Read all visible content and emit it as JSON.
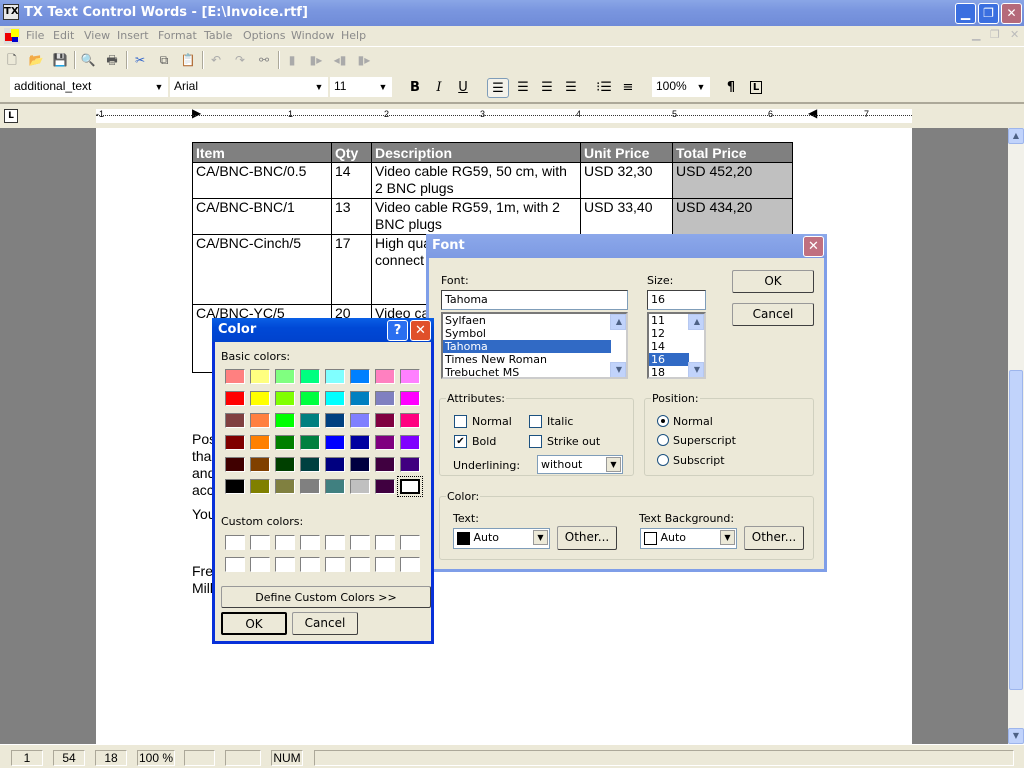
{
  "window": {
    "title": "TX Text Control Words - [E:\\Invoice.rtf]",
    "app_icon": "TX"
  },
  "menu": [
    "File",
    "Edit",
    "View",
    "Insert",
    "Format",
    "Table",
    "Options",
    "Window",
    "Help"
  ],
  "toolbar": {
    "style": "additional_text",
    "font": "Arial",
    "size": "11",
    "zoom": "100%",
    "bold": "B",
    "italic": "I",
    "underline": "U",
    "pilcrow": "¶"
  },
  "ruler": {
    "labels": [
      "-1",
      "1",
      "2",
      "3",
      "4",
      "5",
      "6",
      "7"
    ]
  },
  "document": {
    "table": {
      "headers": [
        "Item",
        "Qty",
        "Description",
        "Unit Price",
        "Total Price"
      ],
      "rows": [
        [
          "CA/BNC-BNC/0.5",
          "14",
          "Video cable RG59, 50 cm, with 2 BNC plugs",
          "USD 32,30",
          "USD 452,20"
        ],
        [
          "CA/BNC-BNC/1",
          "13",
          "Video cable RG59, 1m, with 2 BNC plugs",
          "USD 33,40",
          "USD 434,20"
        ],
        [
          "CA/BNC-Cinch/5",
          "17",
          "High qua the trans signals, connect",
          "",
          ""
        ],
        [
          "CA/BNC-YC/5",
          "20",
          "Video ca",
          "",
          ""
        ]
      ]
    },
    "paragraphs": [
      "Pos",
      "tha",
      "and",
      "acc"
    ],
    "you": "You",
    "closing": [
      "Fre",
      "Mill"
    ]
  },
  "status": [
    "1",
    "54",
    "18",
    "100 %",
    "",
    "",
    "NUM",
    ""
  ],
  "font_dialog": {
    "title": "Font",
    "font_label": "Font:",
    "font_value": "Tahoma",
    "font_list": [
      "Sylfaen",
      "Symbol",
      "Tahoma",
      "Times New Roman",
      "Trebuchet MS"
    ],
    "font_selected": "Tahoma",
    "size_label": "Size:",
    "size_value": "16",
    "size_list": [
      "11",
      "12",
      "14",
      "16",
      "18"
    ],
    "size_selected": "16",
    "ok": "OK",
    "cancel": "Cancel",
    "attributes_label": "Attributes:",
    "normal": "Normal",
    "italic": "Italic",
    "bold": "Bold",
    "strike": "Strike out",
    "bold_checked": true,
    "underlining_label": "Underlining:",
    "underlining_value": "without",
    "position_label": "Position:",
    "pos_normal": "Normal",
    "pos_super": "Superscript",
    "pos_sub": "Subscript",
    "position_selected": "Normal",
    "color_label": "Color:",
    "text_label": "Text:",
    "text_color": "Auto",
    "text_swatch": "#000000",
    "bg_label": "Text Background:",
    "bg_color": "Auto",
    "bg_swatch": "#ffffff",
    "other": "Other..."
  },
  "color_dialog": {
    "title": "Color",
    "help": "?",
    "basic_label": "Basic colors:",
    "basic_colors": [
      "#ff8080",
      "#ffff80",
      "#80ff80",
      "#00ff80",
      "#80ffff",
      "#0080ff",
      "#ff80c0",
      "#ff80ff",
      "#ff0000",
      "#ffff00",
      "#80ff00",
      "#00ff40",
      "#00ffff",
      "#0080c0",
      "#8080c0",
      "#ff00ff",
      "#804040",
      "#ff8040",
      "#00ff00",
      "#008080",
      "#004080",
      "#8080ff",
      "#800040",
      "#ff0080",
      "#800000",
      "#ff8000",
      "#008000",
      "#008040",
      "#0000ff",
      "#0000a0",
      "#800080",
      "#8000ff",
      "#400000",
      "#804000",
      "#004000",
      "#004040",
      "#000080",
      "#000040",
      "#400040",
      "#400080",
      "#000000",
      "#808000",
      "#808040",
      "#808080",
      "#408080",
      "#c0c0c0",
      "#400040",
      "#ffffff"
    ],
    "selected_index": 47,
    "custom_label": "Custom colors:",
    "custom_count": 16,
    "define": "Define Custom Colors >>",
    "ok": "OK",
    "cancel": "Cancel"
  }
}
